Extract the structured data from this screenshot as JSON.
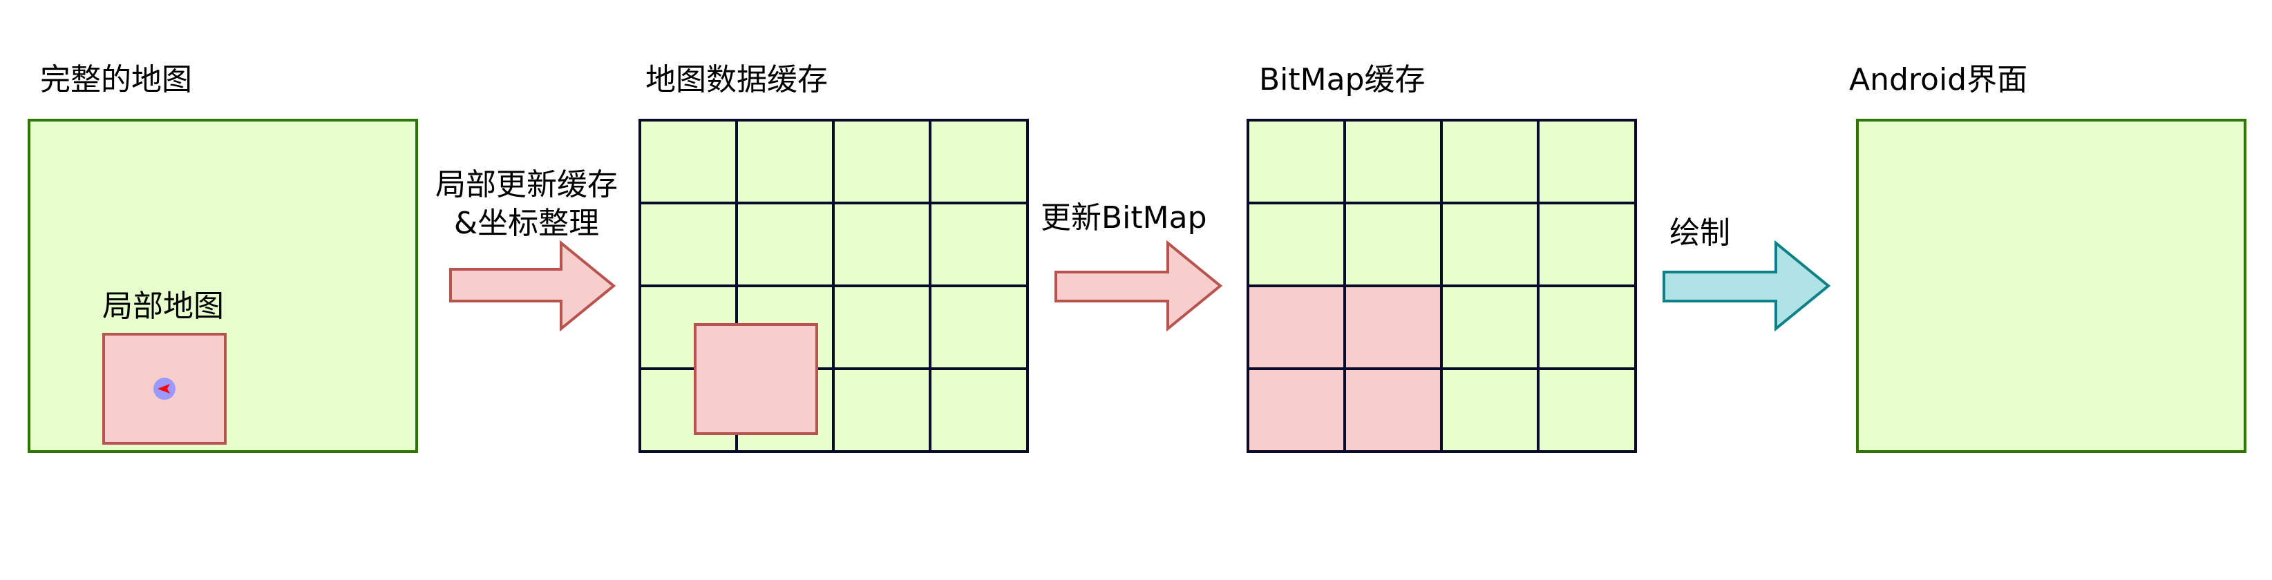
{
  "titles": {
    "full_map": "完整的地图",
    "map_cache": "地图数据缓存",
    "bitmap_cache": "BitMap缓存",
    "android_ui": "Android界面"
  },
  "local_map_label": "局部地图",
  "arrows": {
    "partial_update_line1": "局部更新缓存",
    "partial_update_line2": "&坐标整理",
    "update_bitmap": "更新BitMap",
    "draw": "绘制"
  },
  "colors": {
    "green_fill": "#e6ffcc",
    "green_stroke": "#2d7600",
    "pink_fill": "#f8cecc",
    "pink_stroke": "#b85450",
    "teal_fill": "#b0e3e6",
    "teal_stroke": "#0e8088",
    "grid_stroke": "#0a0a2a",
    "marker_fill": "#9999ff",
    "marker_arrow": "#ff0000"
  },
  "grids": {
    "map_cache": {
      "cols": 4,
      "rows": 4
    },
    "bitmap_cache": {
      "cols": 4,
      "rows": 4,
      "highlighted_cells": [
        [
          0,
          2
        ],
        [
          1,
          2
        ],
        [
          0,
          3
        ],
        [
          1,
          3
        ]
      ]
    }
  }
}
